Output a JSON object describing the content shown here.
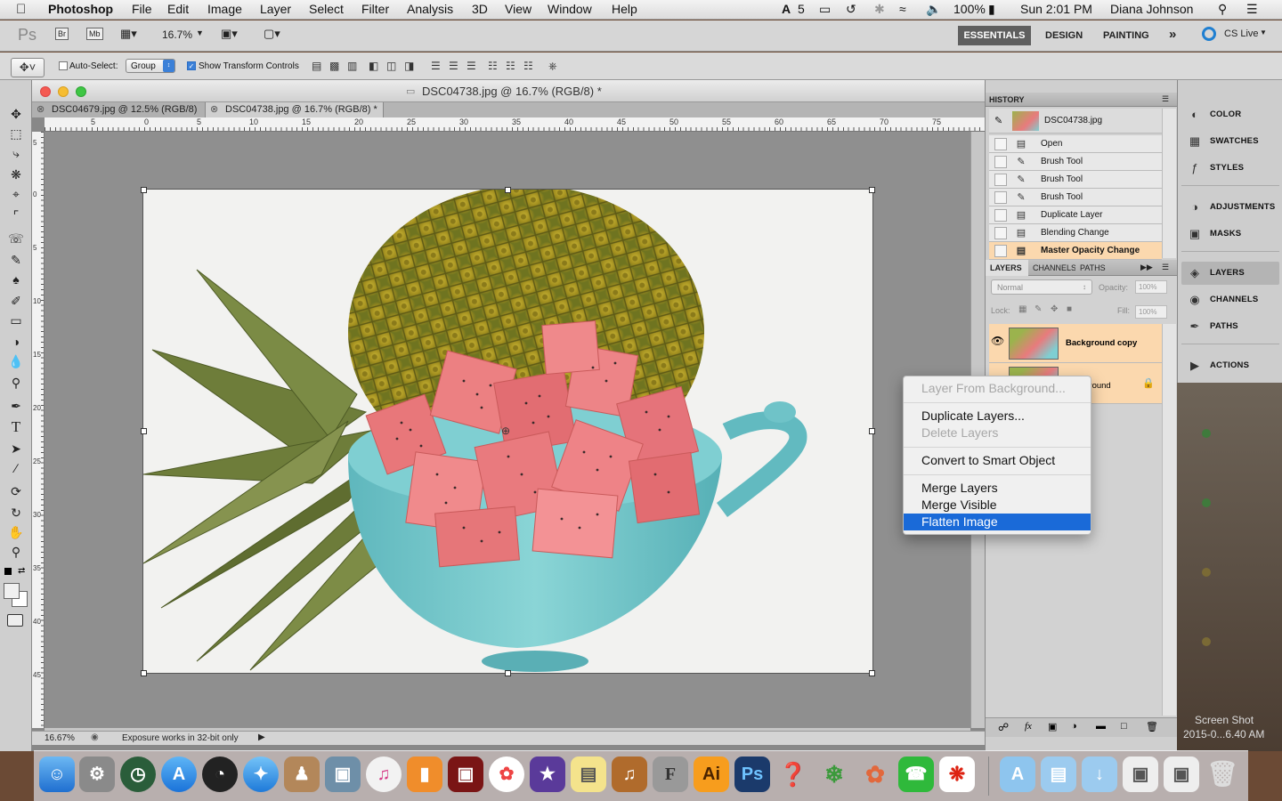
{
  "menubar": {
    "apple": "",
    "app_name": "Photoshop",
    "menus": [
      "File",
      "Edit",
      "Image",
      "Layer",
      "Select",
      "Filter",
      "Analysis",
      "3D",
      "View",
      "Window",
      "Help"
    ],
    "status": {
      "adobe_badge": "5",
      "battery": "100%",
      "clock": "Sun 2:01 PM",
      "user": "Diana Johnson"
    }
  },
  "appbar": {
    "ps_logo": "Ps",
    "br": "Br",
    "mb": "Mb",
    "zoom": "16.7%",
    "workspaces": [
      "ESSENTIALS",
      "DESIGN",
      "PAINTING"
    ],
    "more": "»",
    "cs_live": "CS Live"
  },
  "options": {
    "auto_select_label": "Auto-Select:",
    "auto_select_checked": false,
    "auto_select_value": "Group",
    "show_transform_label": "Show Transform Controls",
    "show_transform_checked": true
  },
  "document": {
    "window_title": "DSC04738.jpg @ 16.7% (RGB/8) *",
    "tabs": [
      {
        "label": "DSC04679.jpg @ 12.5% (RGB/8)",
        "active": false
      },
      {
        "label": "DSC04738.jpg @ 16.7% (RGB/8) *",
        "active": true
      }
    ],
    "ruler_top": [
      "5",
      "0",
      "5",
      "10",
      "15",
      "20",
      "25",
      "30",
      "35",
      "40",
      "45",
      "50",
      "55",
      "60",
      "65",
      "70",
      "75"
    ],
    "ruler_left": [
      "5",
      "0",
      "5",
      "10",
      "15",
      "20",
      "25",
      "30",
      "35",
      "40",
      "45"
    ],
    "status_zoom": "16.67%",
    "status_text": "Exposure works in 32-bit only"
  },
  "history": {
    "tab": "HISTORY",
    "snapshot": "DSC04738.jpg",
    "items": [
      "Open",
      "Brush Tool",
      "Brush Tool",
      "Brush Tool",
      "Duplicate Layer",
      "Blending Change",
      "Master Opacity Change"
    ]
  },
  "layers": {
    "tabs": [
      "LAYERS",
      "CHANNELS",
      "PATHS"
    ],
    "blend_mode": "Normal",
    "opacity_label": "Opacity:",
    "opacity_value": "100%",
    "lock_label": "Lock:",
    "fill_label": "Fill:",
    "fill_value": "100%",
    "items": [
      {
        "name": "Background copy",
        "selected": true
      },
      {
        "name": "Background",
        "selected": false
      }
    ]
  },
  "context_menu": {
    "items": [
      {
        "label": "Layer From Background...",
        "disabled": true
      },
      {
        "label": "Duplicate Layers...",
        "disabled": false
      },
      {
        "label": "Delete Layers",
        "disabled": true
      },
      {
        "label": "Convert to Smart Object",
        "disabled": false
      },
      {
        "label": "Merge Layers",
        "disabled": false
      },
      {
        "label": "Merge Visible",
        "disabled": false
      },
      {
        "label": "Flatten Image",
        "disabled": false,
        "highlighted": true
      }
    ]
  },
  "dock_panel": {
    "items": [
      "COLOR",
      "SWATCHES",
      "STYLES",
      "ADJUSTMENTS",
      "MASKS",
      "LAYERS",
      "CHANNELS",
      "PATHS",
      "ACTIONS"
    ]
  },
  "desktop": {
    "screenshot_label_1": "Screen Shot",
    "screenshot_label_2": "2015-0...6.40 AM"
  },
  "dock": {
    "apps": [
      "Finder",
      "System Preferences",
      "Time Machine",
      "App Store",
      "Dashboard",
      "Safari",
      "Contacts",
      "Preview",
      "iTunes",
      "iBooks",
      "Photo Booth",
      "Photos",
      "iMovie",
      "Stickies",
      "GarageBand",
      "Font Book",
      "Illustrator",
      "Photoshop",
      "Dreamweaver",
      "Fireworks",
      "Flash",
      "FaceTime",
      "Acrobat",
      "Applications",
      "Documents",
      "Downloads",
      "Screenshot",
      "Screenshot",
      "Trash"
    ]
  }
}
